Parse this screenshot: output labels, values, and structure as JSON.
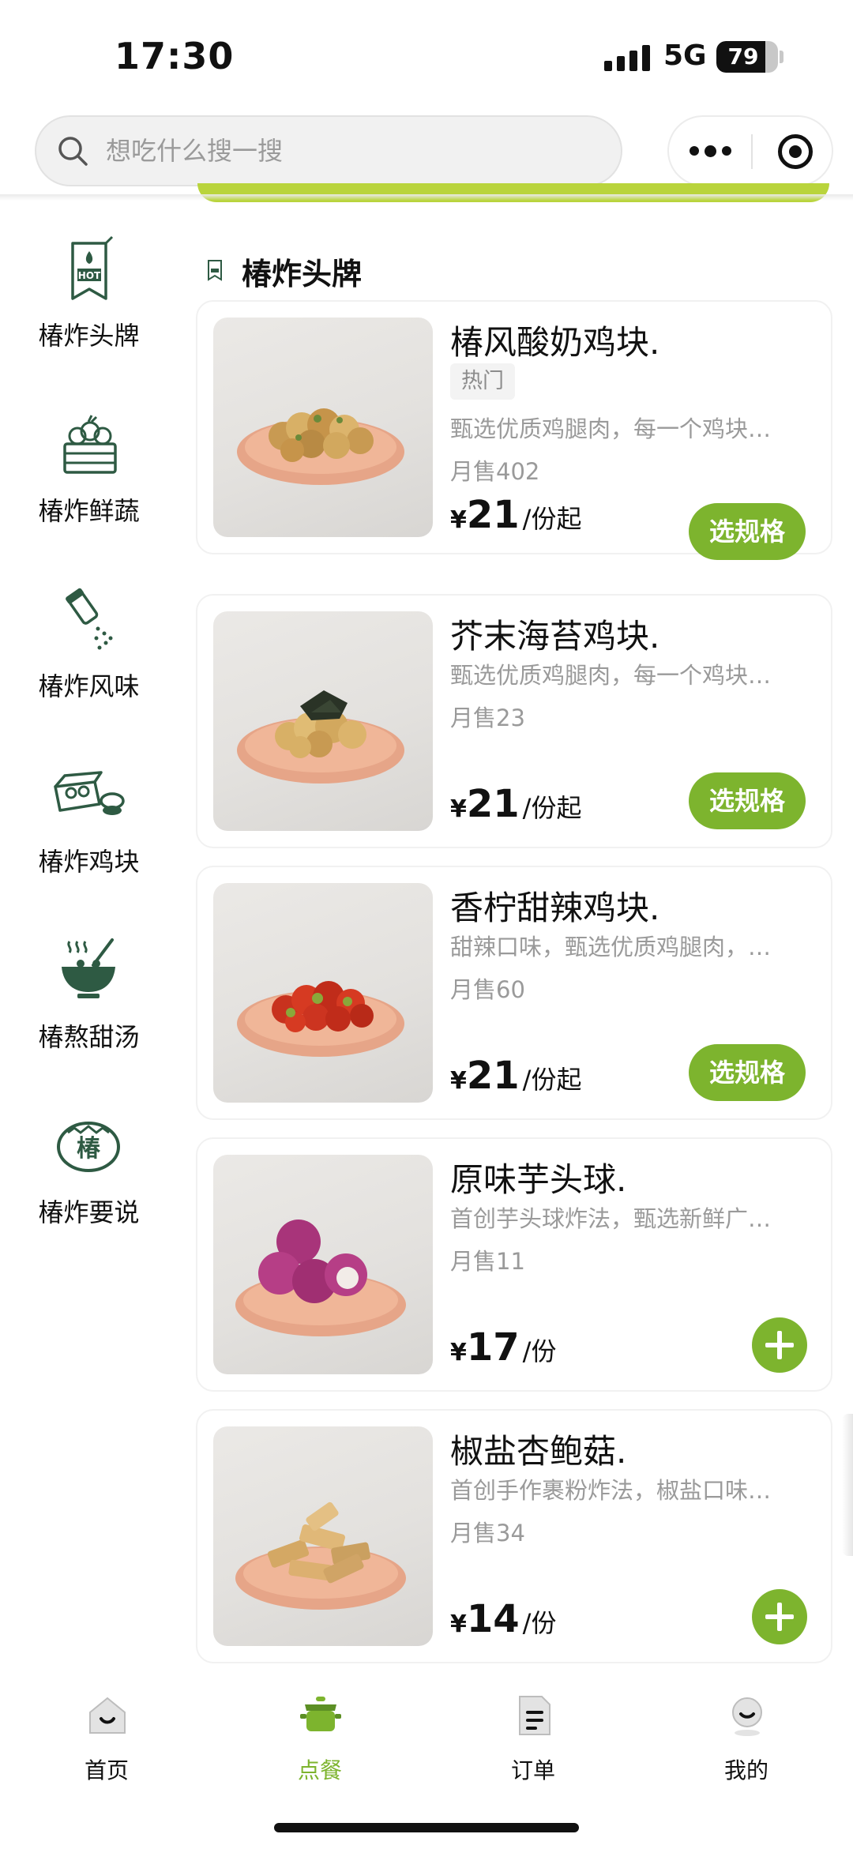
{
  "status_bar": {
    "time": "17:30",
    "network": "5G",
    "battery": "79",
    "battery_level": 0.79
  },
  "search": {
    "placeholder": "想吃什么搜一搜",
    "value": ""
  },
  "capsule": {
    "more_icon": "more-dots-icon",
    "close_icon": "target-close-icon"
  },
  "sidebar": {
    "items": [
      {
        "label": "椿炸头牌",
        "icon": "hot-flag-icon"
      },
      {
        "label": "椿炸鲜蔬",
        "icon": "vegetable-basket-icon"
      },
      {
        "label": "椿炸风味",
        "icon": "salt-shaker-icon"
      },
      {
        "label": "椿炸鸡块",
        "icon": "takeout-box-icon"
      },
      {
        "label": "椿熬甜汤",
        "icon": "soup-bowl-icon"
      },
      {
        "label": "椿炸要说",
        "icon": "chun-badge-icon"
      }
    ]
  },
  "section": {
    "title": "椿炸头牌",
    "icon": "hot-flag-icon"
  },
  "products": [
    {
      "name": "椿风酸奶鸡块.",
      "tag": "热门",
      "desc": "甄选优质鸡腿肉，每一个鸡块…",
      "sales": "月售402",
      "currency": "¥",
      "price": "21",
      "unit": "/份起",
      "action": "选规格"
    },
    {
      "name": "芥末海苔鸡块.",
      "tag": "",
      "desc": "甄选优质鸡腿肉，每一个鸡块…",
      "sales": "月售23",
      "currency": "¥",
      "price": "21",
      "unit": "/份起",
      "action": "选规格"
    },
    {
      "name": "香柠甜辣鸡块.",
      "tag": "",
      "desc": "甜辣口味，甄选优质鸡腿肉，…",
      "sales": "月售60",
      "currency": "¥",
      "price": "21",
      "unit": "/份起",
      "action": "选规格"
    },
    {
      "name": "原味芋头球.",
      "tag": "",
      "desc": "首创芋头球炸法，甄选新鲜广…",
      "sales": "月售11",
      "currency": "¥",
      "price": "17",
      "unit": "/份",
      "action": ""
    },
    {
      "name": "椒盐杏鲍菇.",
      "tag": "",
      "desc": "首创手作裹粉炸法，椒盐口味…",
      "sales": "月售34",
      "currency": "¥",
      "price": "14",
      "unit": "/份",
      "action": ""
    }
  ],
  "tabbar": {
    "items": [
      {
        "label": "首页",
        "icon": "home-icon"
      },
      {
        "label": "点餐",
        "icon": "pot-icon",
        "active": true
      },
      {
        "label": "订单",
        "icon": "order-doc-icon"
      },
      {
        "label": "我的",
        "icon": "profile-icon"
      }
    ]
  },
  "colors": {
    "accent": "#7db42e",
    "banner": "#b9d43c",
    "icon_green": "#2e5a43",
    "text_muted": "#9a9a9a"
  }
}
